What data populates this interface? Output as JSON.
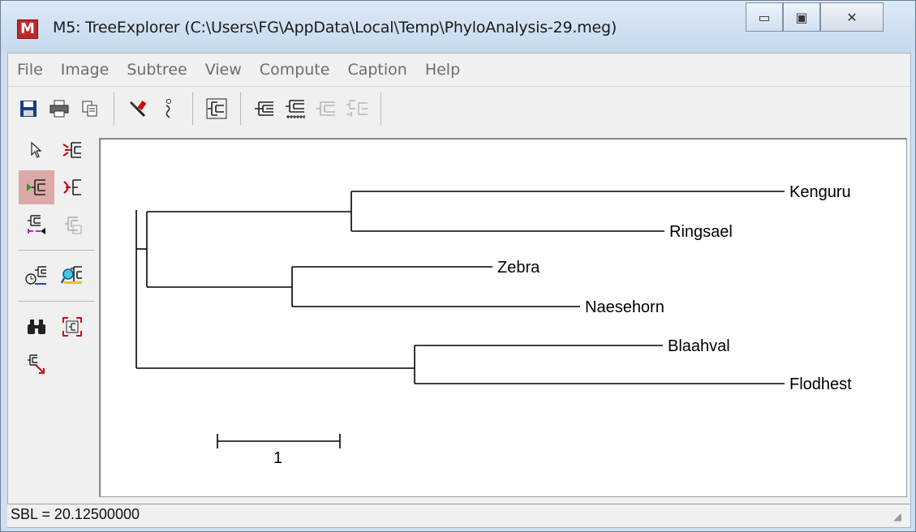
{
  "window": {
    "title": "M5: TreeExplorer (C:\\Users\\FG\\AppData\\Local\\Temp\\PhyloAnalysis-29.meg)",
    "icon_letter": "M",
    "minimize_glyph": "▭",
    "maximize_glyph": "▣",
    "close_glyph": "✕"
  },
  "menu": [
    "File",
    "Image",
    "Subtree",
    "View",
    "Compute",
    "Caption",
    "Help"
  ],
  "toolbar": [
    {
      "icon": "save-icon",
      "glyph": "💾"
    },
    {
      "icon": "print-icon",
      "glyph": "🖨"
    },
    {
      "icon": "copy-icon",
      "glyph": "⎘"
    },
    {
      "icon": "options-icon",
      "glyph": "🔧"
    },
    {
      "icon": "info-icon",
      "glyph": "ℹ"
    },
    {
      "icon": "topology-icon",
      "glyph": "⊞"
    },
    {
      "icon": "tree-icon",
      "glyph": "⊏"
    },
    {
      "icon": "tree-scale-icon",
      "glyph": "⊐"
    },
    {
      "icon": "tree-disabled-icon",
      "glyph": "⊏"
    },
    {
      "icon": "tree-caption-disabled-icon",
      "glyph": "⊐"
    }
  ],
  "tree": {
    "taxa": [
      "Kenguru",
      "Ringsael",
      "Zebra",
      "Naesehorn",
      "Blaahval",
      "Flodhest"
    ],
    "scale_label": "1"
  },
  "status": {
    "text": "SBL = 20.12500000"
  }
}
